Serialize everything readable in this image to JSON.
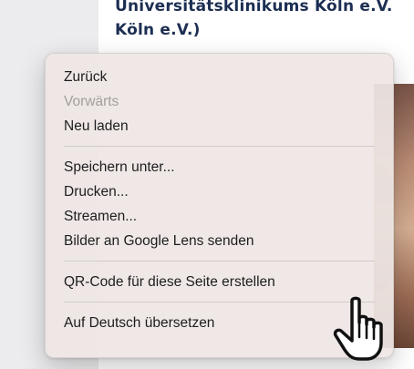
{
  "page": {
    "title_line1": "Universitätsklinikums Köln e.V.",
    "title_line2": "Köln e.V.)"
  },
  "context_menu": {
    "items": [
      {
        "label": "Zurück",
        "enabled": true
      },
      {
        "label": "Vorwärts",
        "enabled": false
      },
      {
        "label": "Neu laden",
        "enabled": true
      },
      {
        "label": "Speichern unter...",
        "enabled": true
      },
      {
        "label": "Drucken...",
        "enabled": true
      },
      {
        "label": "Streamen...",
        "enabled": true
      },
      {
        "label": "Bilder an Google Lens senden",
        "enabled": true
      },
      {
        "label": "QR-Code für diese Seite erstellen",
        "enabled": true
      },
      {
        "label": "Auf Deutsch übersetzen",
        "enabled": true
      }
    ]
  },
  "cursor": {
    "icon": "pointing-hand-icon"
  },
  "colors": {
    "title": "#1c2e52",
    "menu_text": "#1d1d1f",
    "menu_disabled_text": "#a39e9d"
  }
}
